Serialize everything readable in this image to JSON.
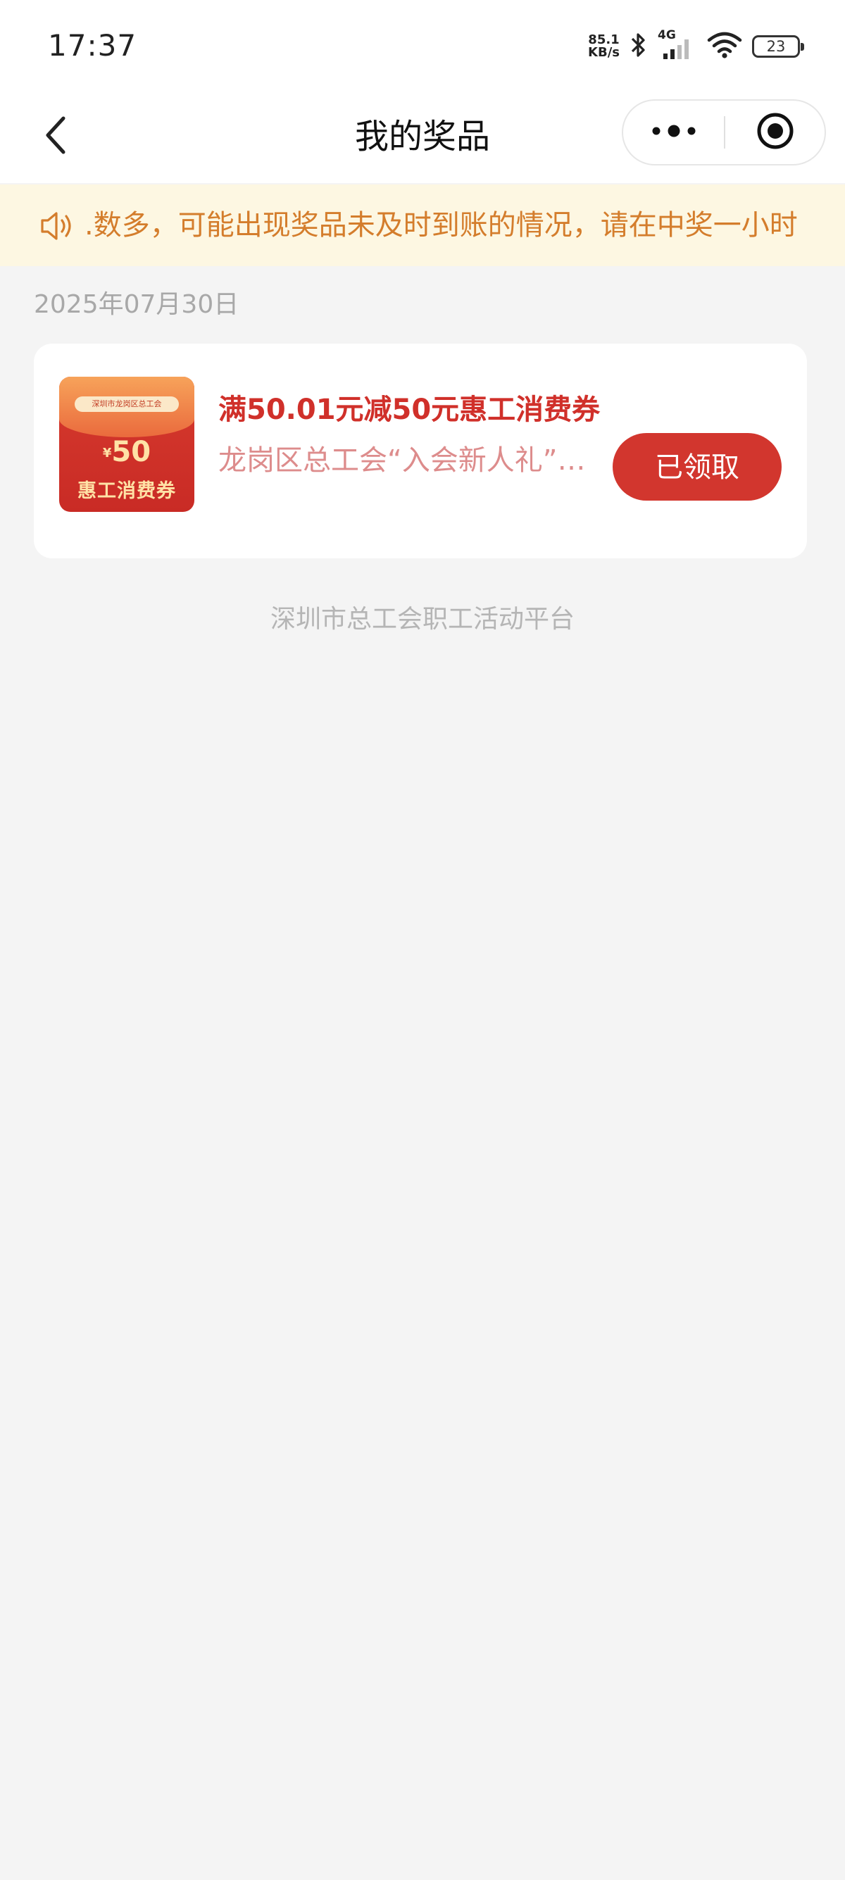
{
  "status_bar": {
    "time": "17:37",
    "net_speed_value": "85.1",
    "net_speed_unit": "KB/s",
    "network_type": "4G",
    "battery": "23",
    "icons": [
      "bluetooth-icon",
      "signal-icon",
      "wifi-icon",
      "battery-icon"
    ]
  },
  "nav": {
    "title": "我的奖品",
    "icons": [
      "back-arrow-icon",
      "more-icon",
      "close-target-icon"
    ]
  },
  "notice": {
    "icon": "speaker-icon",
    "text": ".数多，可能出现奖品未及时到账的情况，请在中奖一小时"
  },
  "prizes": {
    "date": "2025年07月30日",
    "items": [
      {
        "thumb_badge": "深圳市龙岗区总工会",
        "thumb_currency": "¥",
        "thumb_amount": "50",
        "thumb_name": "惠工消费券",
        "title": "满50.01元减50元惠工消费券",
        "subtitle": "龙岗区总工会“入会新人礼”活动",
        "button_label": "已领取"
      }
    ]
  },
  "footer": {
    "text": "深圳市总工会职工活动平台"
  },
  "colors": {
    "accent_red": "#d2362e",
    "notice_text": "#d47d2c",
    "notice_bg": "#fdf7e2",
    "page_bg": "#f4f4f4"
  }
}
